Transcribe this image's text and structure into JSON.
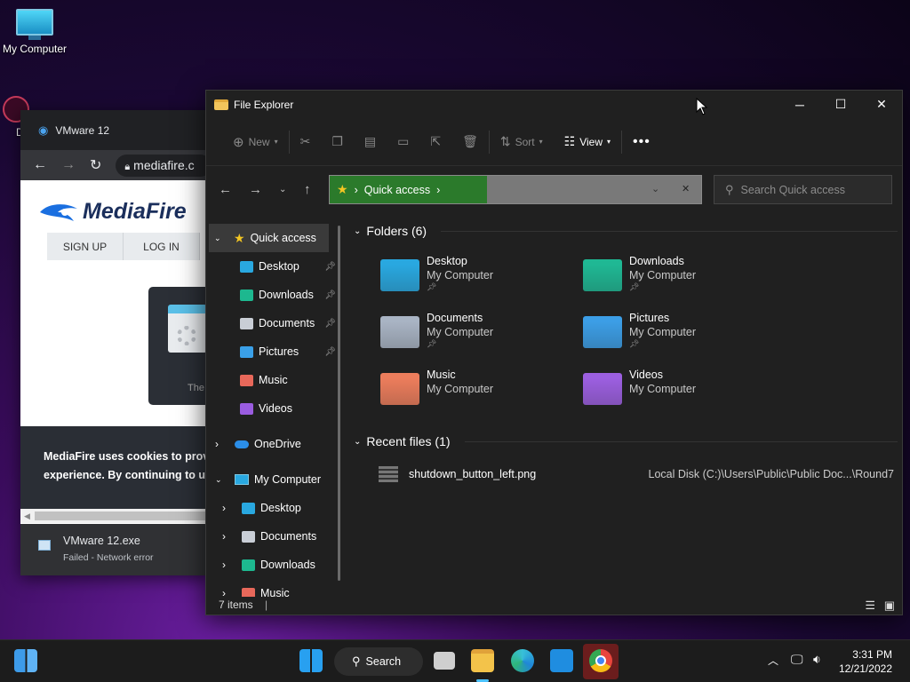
{
  "desktop": {
    "icons": [
      {
        "label": "My Computer",
        "icon": "monitor-icon"
      },
      {
        "label": "Data",
        "icon": "shortcut-icon"
      }
    ]
  },
  "chrome": {
    "tab_title": "VMware 12",
    "url": "mediafire.c",
    "logo": "MediaFire",
    "signup": "SIGN UP",
    "login": "LOG IN",
    "card_text": "The",
    "cookie_line1": "MediaFire uses cookies to provi",
    "cookie_line2": "experience. By continuing to us",
    "download": {
      "filename": "VMware 12.exe",
      "status": "Failed - Network error"
    }
  },
  "explorer": {
    "title": "File Explorer",
    "toolbar": {
      "new": "New",
      "sort": "Sort",
      "view": "View"
    },
    "address": {
      "crumb": "Quick access"
    },
    "search": {
      "placeholder": "Search Quick access"
    },
    "nav": {
      "quick_access": "Quick access",
      "qa_items": [
        {
          "label": "Desktop",
          "icon": "desktop-icon",
          "pinned": true,
          "color": "#29a8e0"
        },
        {
          "label": "Downloads",
          "icon": "download-icon",
          "pinned": true,
          "color": "#1db88f"
        },
        {
          "label": "Documents",
          "icon": "document-icon",
          "pinned": true,
          "color": "#c9ced6"
        },
        {
          "label": "Pictures",
          "icon": "picture-icon",
          "pinned": true,
          "color": "#3aa0e8"
        },
        {
          "label": "Music",
          "icon": "music-icon",
          "pinned": false,
          "color": "#e8685a"
        },
        {
          "label": "Videos",
          "icon": "video-icon",
          "pinned": false,
          "color": "#9a5ce0"
        }
      ],
      "onedrive": "OneDrive",
      "my_computer": "My Computer",
      "mc_items": [
        {
          "label": "Desktop",
          "icon": "desktop-icon",
          "color": "#29a8e0"
        },
        {
          "label": "Documents",
          "icon": "document-icon",
          "color": "#c9ced6"
        },
        {
          "label": "Downloads",
          "icon": "download-icon",
          "color": "#1db88f"
        },
        {
          "label": "Music",
          "icon": "music-icon",
          "color": "#e8685a"
        }
      ]
    },
    "folders_header": "Folders (6)",
    "folders": [
      {
        "name": "Desktop",
        "location": "My Computer",
        "pinned": true,
        "icon": "desktop-folder-icon",
        "color": "#29a8e0"
      },
      {
        "name": "Downloads",
        "location": "My Computer",
        "pinned": true,
        "icon": "downloads-folder-icon",
        "color": "#1fb894"
      },
      {
        "name": "Documents",
        "location": "My Computer",
        "pinned": true,
        "icon": "documents-folder-icon",
        "color": "#a9b4c4"
      },
      {
        "name": "Pictures",
        "location": "My Computer",
        "pinned": true,
        "icon": "pictures-folder-icon",
        "color": "#3c9ee6"
      },
      {
        "name": "Music",
        "location": "My Computer",
        "pinned": false,
        "icon": "music-folder-icon",
        "color": "#ec7d5c"
      },
      {
        "name": "Videos",
        "location": "My Computer",
        "pinned": false,
        "icon": "videos-folder-icon",
        "color": "#9c5fe0"
      }
    ],
    "recent_header": "Recent files (1)",
    "recent": [
      {
        "name": "shutdown_button_left.png",
        "path": "Local Disk (C:)\\Users\\Public\\Public Doc...\\Round7"
      }
    ],
    "status": "7 items"
  },
  "taskbar": {
    "search": "Search",
    "time": "3:31 PM",
    "date": "12/21/2022"
  }
}
